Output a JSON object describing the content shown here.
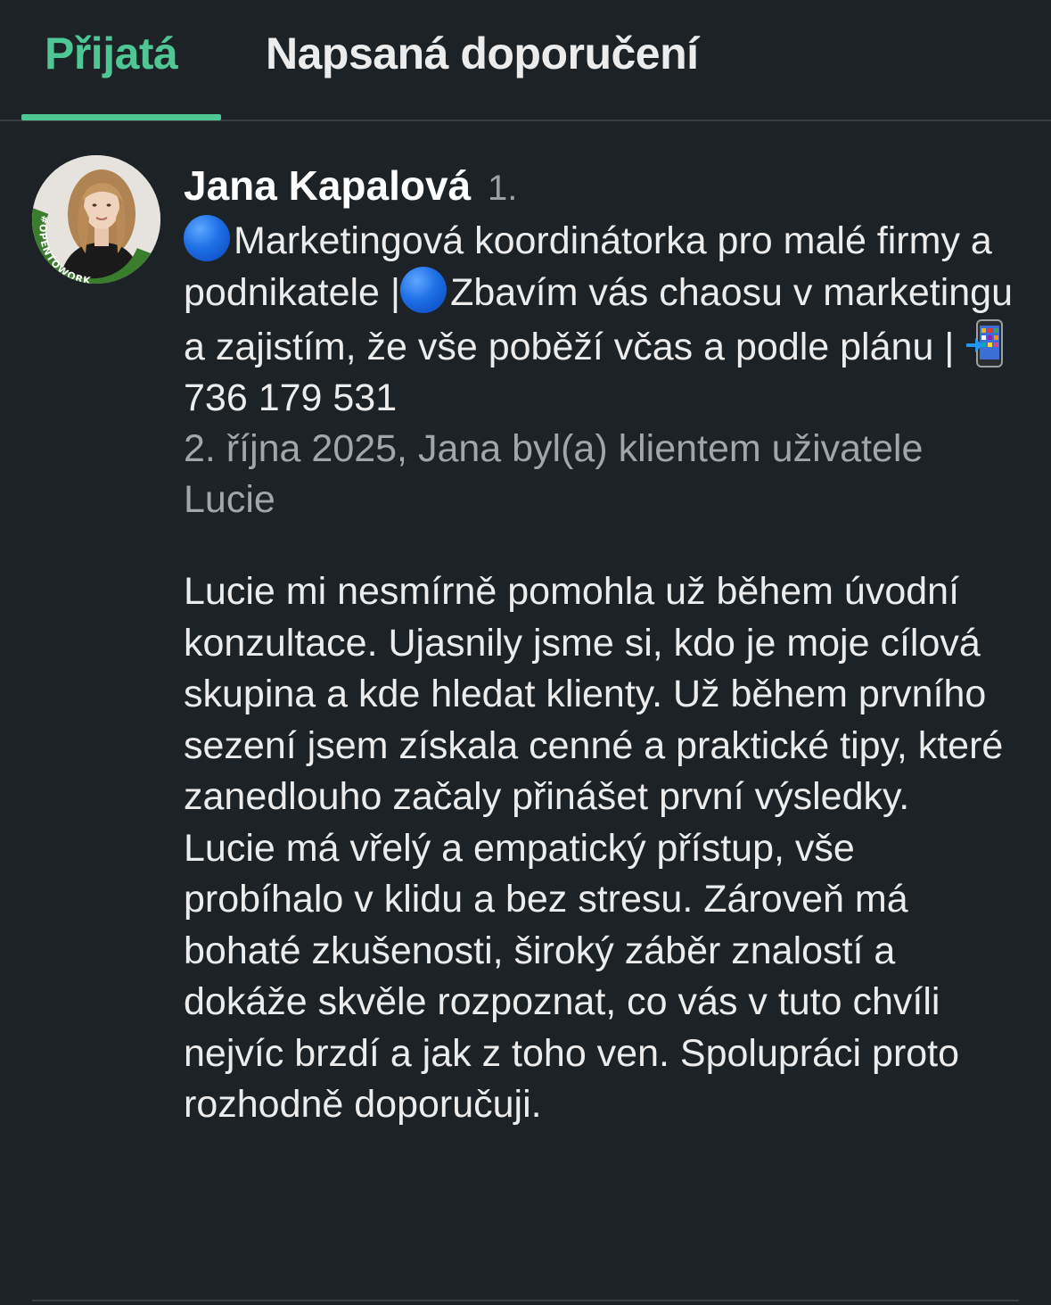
{
  "tabs": [
    {
      "label": "Přijatá",
      "active": true
    },
    {
      "label": "Napsaná doporučení",
      "active": false
    }
  ],
  "colors": {
    "background": "#1d2226",
    "accent": "#4ec795",
    "text_primary": "#ececec",
    "text_secondary": "#a2a6ab",
    "divider": "#3a3f44"
  },
  "recommendation": {
    "author_name": "Jana Kapalová",
    "connection_degree": "1.",
    "avatar_badge": "#OPENTOWORK",
    "headline_part1": "Marketingová koordinátorka pro malé firmy a podnikatele |",
    "headline_part2": "Zbavím vás chaosu v marketingu a zajistím, že vše poběží včas a podle plánu |",
    "headline_phone": "736 179 531",
    "icons": [
      "blue-circle-icon",
      "blue-circle-icon",
      "mobile-phone-arrow-icon"
    ],
    "meta": "2. října 2025, Jana byl(a) klientem uživatele Lucie",
    "text": "Lucie mi nesmírně pomohla už během úvodní konzultace. Ujasnily jsme si, kdo je moje cílová skupina a kde hledat klienty. Už během prvního sezení jsem získala cenné a praktické tipy, které zanedlouho začaly přinášet první výsledky. Lucie má vřelý a empatický přístup, vše probíhalo v klidu a bez stresu. Zároveň má bohaté zkušenosti, široký záběr znalostí a dokáže skvěle rozpoznat, co vás v tuto chvíli nejvíc brzdí a jak z toho ven. Spolupráci proto rozhodně doporučuji."
  }
}
